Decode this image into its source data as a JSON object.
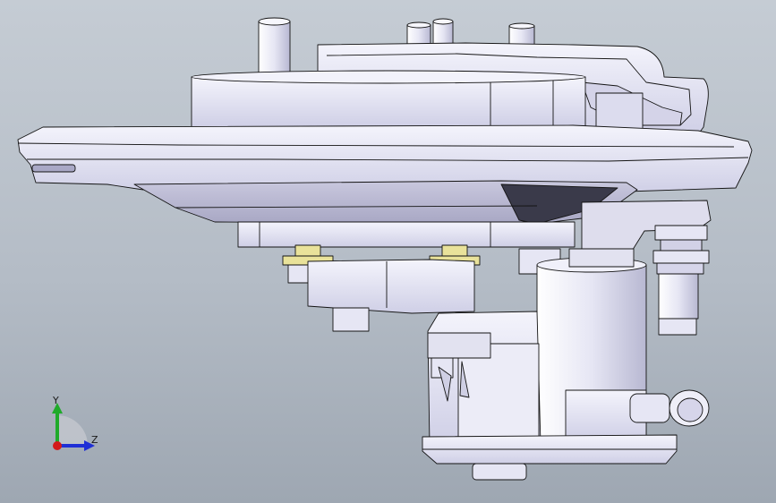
{
  "viewport": {
    "background_top": "#c5ccd4",
    "background_bottom": "#9ea7b2"
  },
  "model": {
    "body_color": "#e6e6f4",
    "shade_color": "#b9b8d2",
    "dark_color": "#3a3a4a",
    "washer_color": "#e9e29a",
    "edge_color": "#141414"
  },
  "triad": {
    "y_label": "Y",
    "z_label": "Z",
    "y_color": "#1faa2a",
    "z_color": "#1f2fd6",
    "x_color": "#d41a1a",
    "icons": [
      "y-axis-arrow-icon",
      "z-axis-arrow-icon",
      "x-axis-origin-icon",
      "plane-indicator-icon"
    ]
  }
}
